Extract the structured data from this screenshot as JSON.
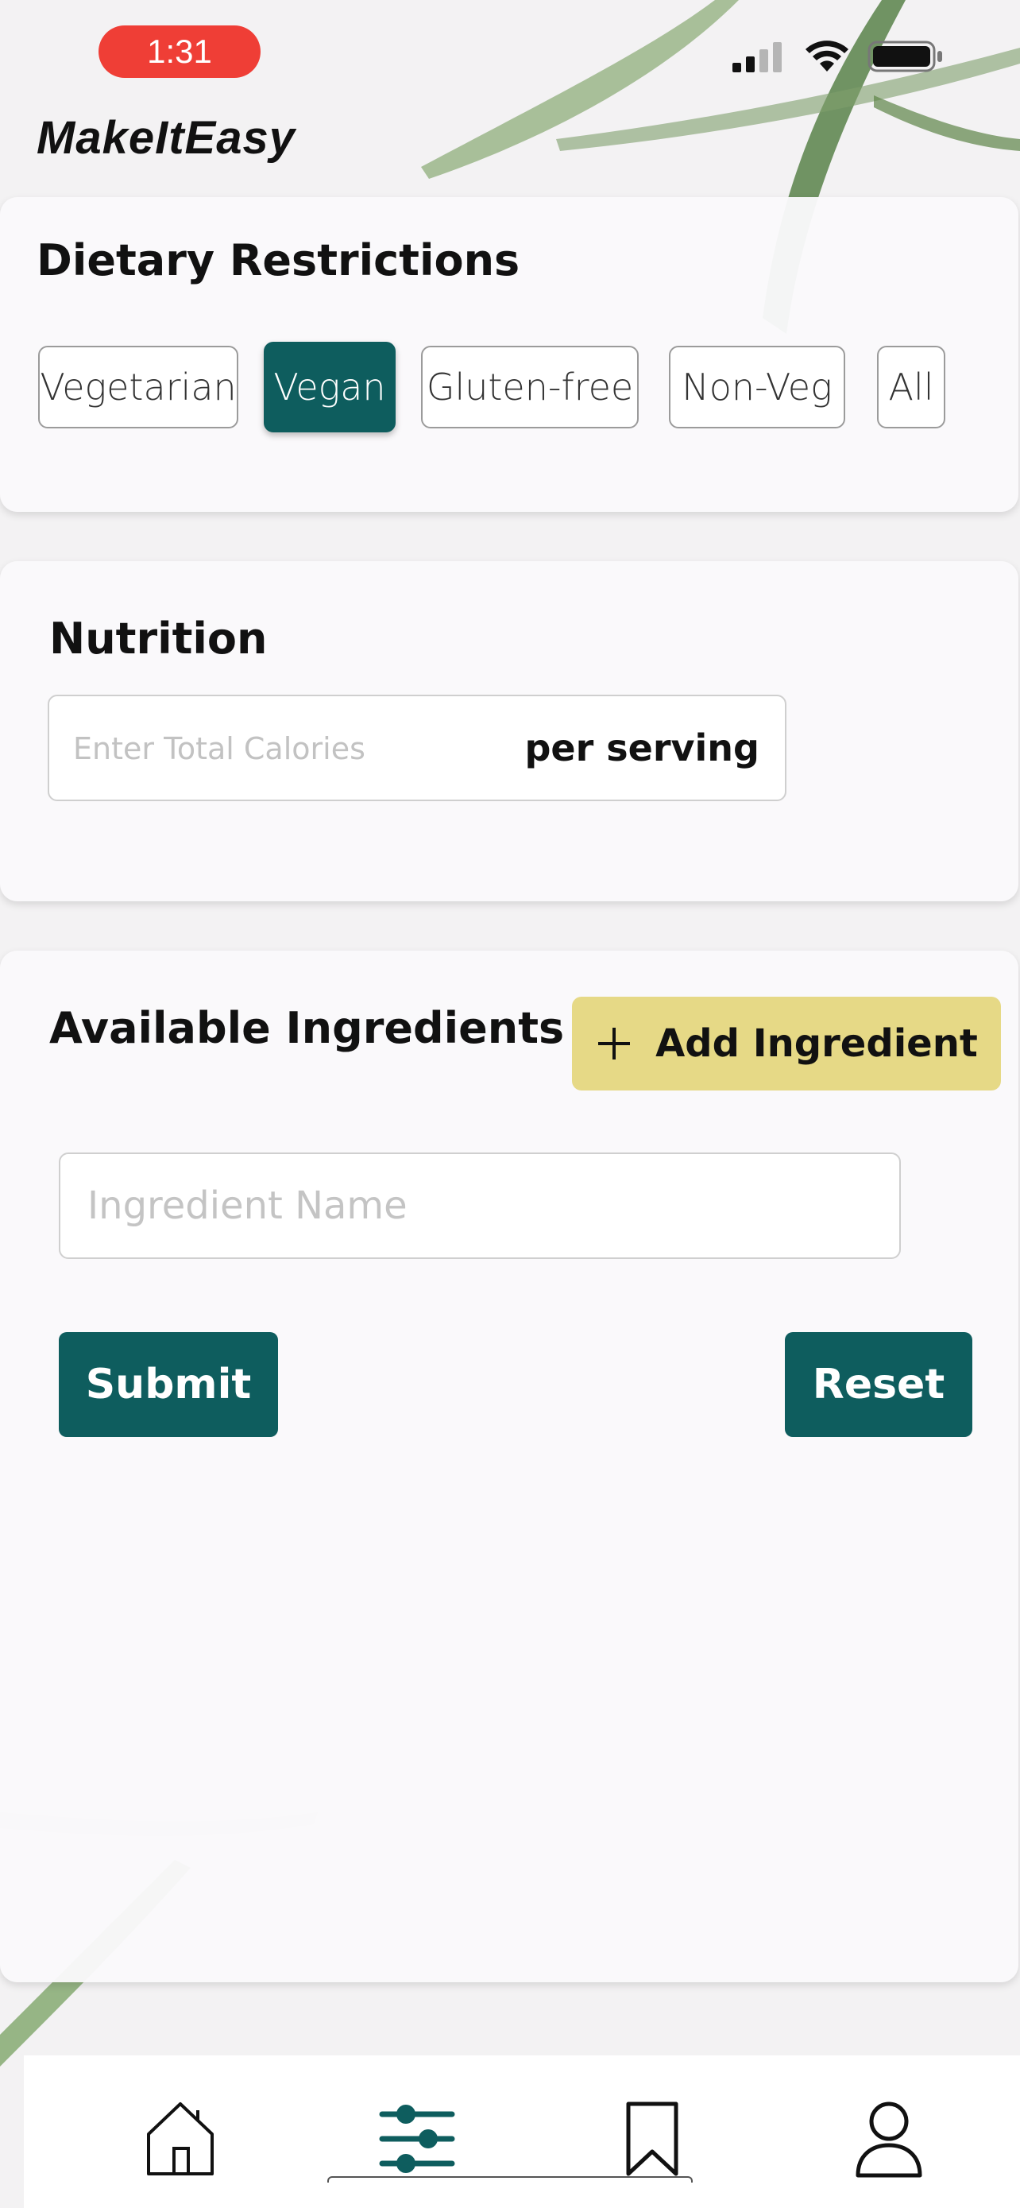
{
  "status_bar": {
    "time": "1:31",
    "icons": [
      "cellular-signal-icon",
      "wifi-icon",
      "battery-icon"
    ]
  },
  "app": {
    "title": "MakeItEasy"
  },
  "dietary": {
    "title": "Dietary Restrictions",
    "options": [
      {
        "label": "Vegetarian",
        "selected": false
      },
      {
        "label": "Vegan",
        "selected": true
      },
      {
        "label": "Gluten-free",
        "selected": false
      },
      {
        "label": "Non-Veg",
        "selected": false
      },
      {
        "label": "All",
        "selected": false
      }
    ]
  },
  "nutrition": {
    "title": "Nutrition",
    "calories_placeholder": "Enter Total Calories",
    "calories_value": "",
    "unit_label": "per serving"
  },
  "ingredients": {
    "title": "Available Ingredients",
    "add_label": "Add Ingredient",
    "name_placeholder": "Ingredient Name",
    "name_value": "",
    "submit_label": "Submit",
    "reset_label": "Reset"
  },
  "nav": {
    "items": [
      {
        "icon": "home-icon",
        "active": false
      },
      {
        "icon": "filter-sliders-icon",
        "active": true
      },
      {
        "icon": "bookmark-icon",
        "active": false
      },
      {
        "icon": "profile-icon",
        "active": false
      }
    ]
  },
  "colors": {
    "accent_teal": "#0e5d5e",
    "add_button_yellow": "#e6d986",
    "time_pill_red": "#ef3e36"
  }
}
